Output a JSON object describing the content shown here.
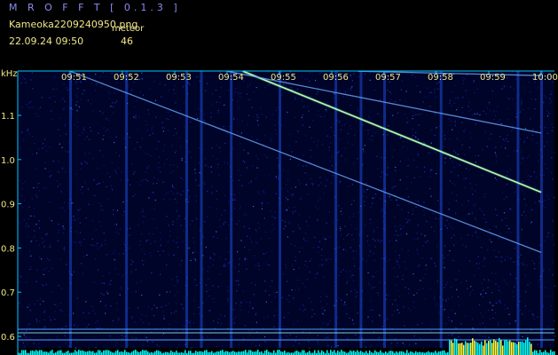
{
  "header": {
    "app_title": "M R O F F T  [ 0.1.3 ]",
    "file_name": "Kameoka2209240950.png",
    "meteor_label": "meteor",
    "timestamp": "22.09.24  09:50",
    "meteor_count": "46"
  },
  "colors": {
    "title": "#8c8cf0",
    "header_text": "#f0e68c",
    "axis_text": "#f0e68c",
    "axis_line": "#00c8ff",
    "noise_floor": "#00ffff",
    "meteor_streak": "#c8ffb4"
  },
  "chart_data": {
    "type": "heatmap",
    "ylabel": "kHz",
    "x_ticks": [
      "09:51",
      "09:52",
      "09:53",
      "09:54",
      "09:55",
      "09:56",
      "09:57",
      "09:58",
      "09:59",
      "10:00"
    ],
    "y_ticks": [
      "1.1",
      "1.0",
      "0.9",
      "0.8",
      "0.7",
      "0.6"
    ],
    "y_tick_values": [
      1.1,
      1.0,
      0.9,
      0.8,
      0.7,
      0.6
    ],
    "ylim": [
      0.59,
      1.2
    ],
    "xlim_minutes": [
      0,
      10
    ],
    "streaks": [
      {
        "t0": 4.3,
        "f0": 1.2,
        "t1": 10.0,
        "f1": 0.926,
        "bright": true
      },
      {
        "t0": 1.0,
        "f0": 1.2,
        "t1": 10.0,
        "f1": 0.79,
        "bright": false
      },
      {
        "t0": 4.0,
        "f0": 1.2,
        "t1": 10.0,
        "f1": 1.06,
        "bright": false
      },
      {
        "t0": 6.5,
        "f0": 1.2,
        "t1": 10.0,
        "f1": 1.19,
        "bright": false
      }
    ],
    "vertical_noise_bands_minutes": [
      1.0,
      2.07,
      3.22,
      3.5,
      4.07,
      5.0,
      6.07,
      6.55,
      7.0,
      8.08,
      9.55,
      10.0
    ]
  }
}
